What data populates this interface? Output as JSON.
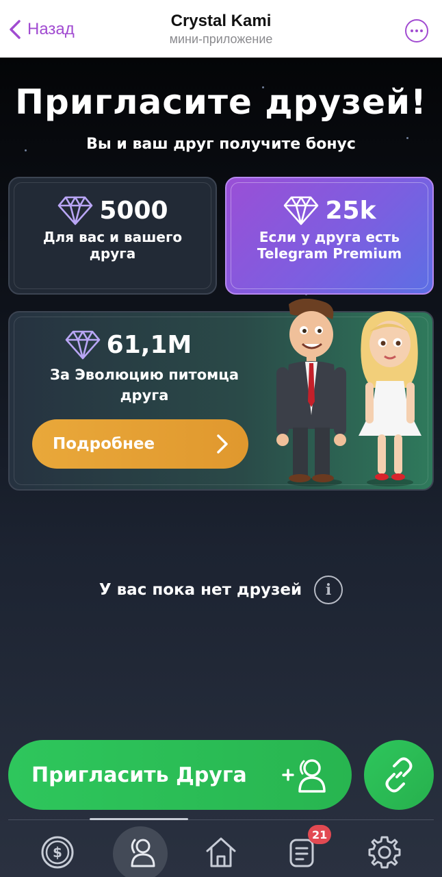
{
  "header": {
    "back_label": "Назад",
    "title": "Crystal Kami",
    "subtitle": "мини-приложение"
  },
  "hero": {
    "headline": "Пригласите друзей!",
    "subline": "Вы и ваш друг получите бонус"
  },
  "bonus_cards": [
    {
      "value": "5000",
      "desc_line1": "Для вас и вашего",
      "desc_line2": "друга"
    },
    {
      "value": "25k",
      "desc_line1": "Если у друга есть",
      "desc_line2": "Telegram Premium"
    }
  ],
  "evolution_card": {
    "value": "61,1M",
    "desc_line1": "За Эволюцию питомца",
    "desc_line2": "друга",
    "button_label": "Подробнее"
  },
  "friends": {
    "empty_text": "У вас пока нет друзей"
  },
  "actions": {
    "invite_label": "Пригласить Друга",
    "invite_icon": "add-user-icon",
    "link_icon": "link-icon"
  },
  "bottom_nav": {
    "items": [
      "dollar-coin-icon",
      "friends-icon",
      "home-icon",
      "tasks-icon",
      "settings-icon"
    ],
    "active_item": "friends-icon",
    "tasks_badge": "21"
  },
  "colors": {
    "accent_purple": "#a14bd1",
    "invite_green": "#2ec65c",
    "details_orange": "#e9a83a",
    "badge_red": "#e24a52"
  }
}
